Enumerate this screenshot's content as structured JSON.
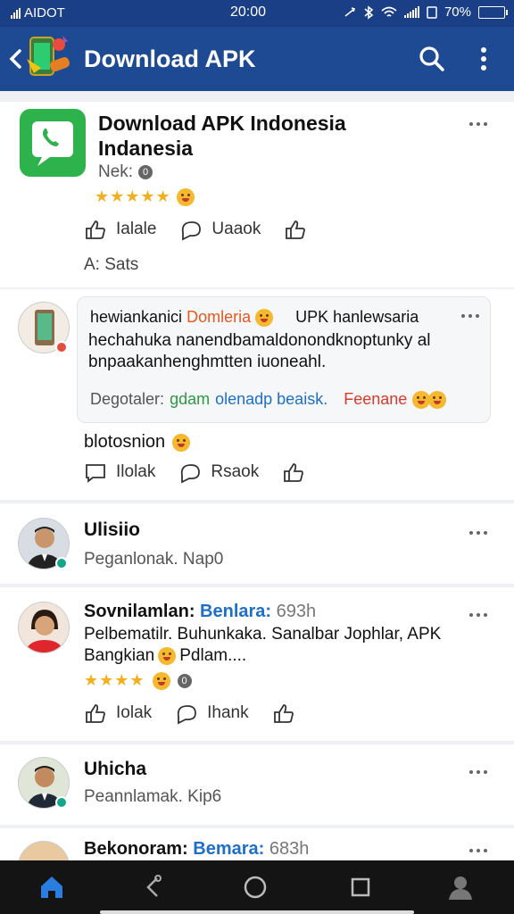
{
  "status_bar": {
    "carrier": "AIDOT",
    "time": "20:00",
    "battery": "70%"
  },
  "app_bar": {
    "title": "Download APK",
    "icons": [
      "back-arrow-icon",
      "app-logo-icon",
      "search-icon",
      "more-vert-icon"
    ]
  },
  "posts": [
    {
      "title_line1": "Download APK Indonesia",
      "title_line2": "Indanesia",
      "meta": "Nek:",
      "meta_badge": "0",
      "stars": "★★★★★",
      "actions": {
        "like": "Ialale",
        "comment": "Uaaok"
      },
      "footer": "A: Sats"
    },
    {
      "comment_intro": "hewiankanici",
      "comment_highlight": "Domleria",
      "comment_tail": "UPK hanlewsaria",
      "comment_line2": "hechahuka nanendbamaldonondknoptunky al",
      "comment_line3": "bnpaakanhenghmtten iuoneahl.",
      "comment_label": "Degotaler:",
      "comment_green": "gdam",
      "comment_blue": "olenadp beaisk.",
      "comment_red": "Feenane",
      "caption": "blotosnion",
      "actions": {
        "like": "Ilolak",
        "comment": "Rsaok"
      }
    },
    {
      "name": "Ulisiio",
      "sub": "Peganlonak. Nap0"
    },
    {
      "name": "Sovnilamlan:",
      "name_highlight": "Benlara:",
      "name_time": "693h",
      "text_line1": "Pelbematilr. Buhunkaka. Sanalbar Jophlar, APK",
      "text_line2_start": "Bangkian",
      "text_line2_end": "Pdlam....",
      "stars": "★★★★",
      "badge": "0",
      "actions": {
        "like": "Iolak",
        "comment": "Ihank"
      }
    },
    {
      "name": "Uhicha",
      "sub": "Peannlamak. Kip6"
    },
    {
      "name": "Bekonoram:",
      "name_highlight": "Bemara:",
      "name_time": "683h"
    }
  ],
  "bottom_nav": [
    "home-icon",
    "share-icon",
    "circle-home-icon",
    "square-recents-icon",
    "profile-icon"
  ],
  "colors": {
    "app_bar": "#1e4a93",
    "status_bar": "#1b3f86",
    "orange": "#e8571e",
    "blue": "#1e6fc7",
    "green": "#2b9a3f",
    "red": "#d93a2b",
    "star": "#f2b01e"
  }
}
